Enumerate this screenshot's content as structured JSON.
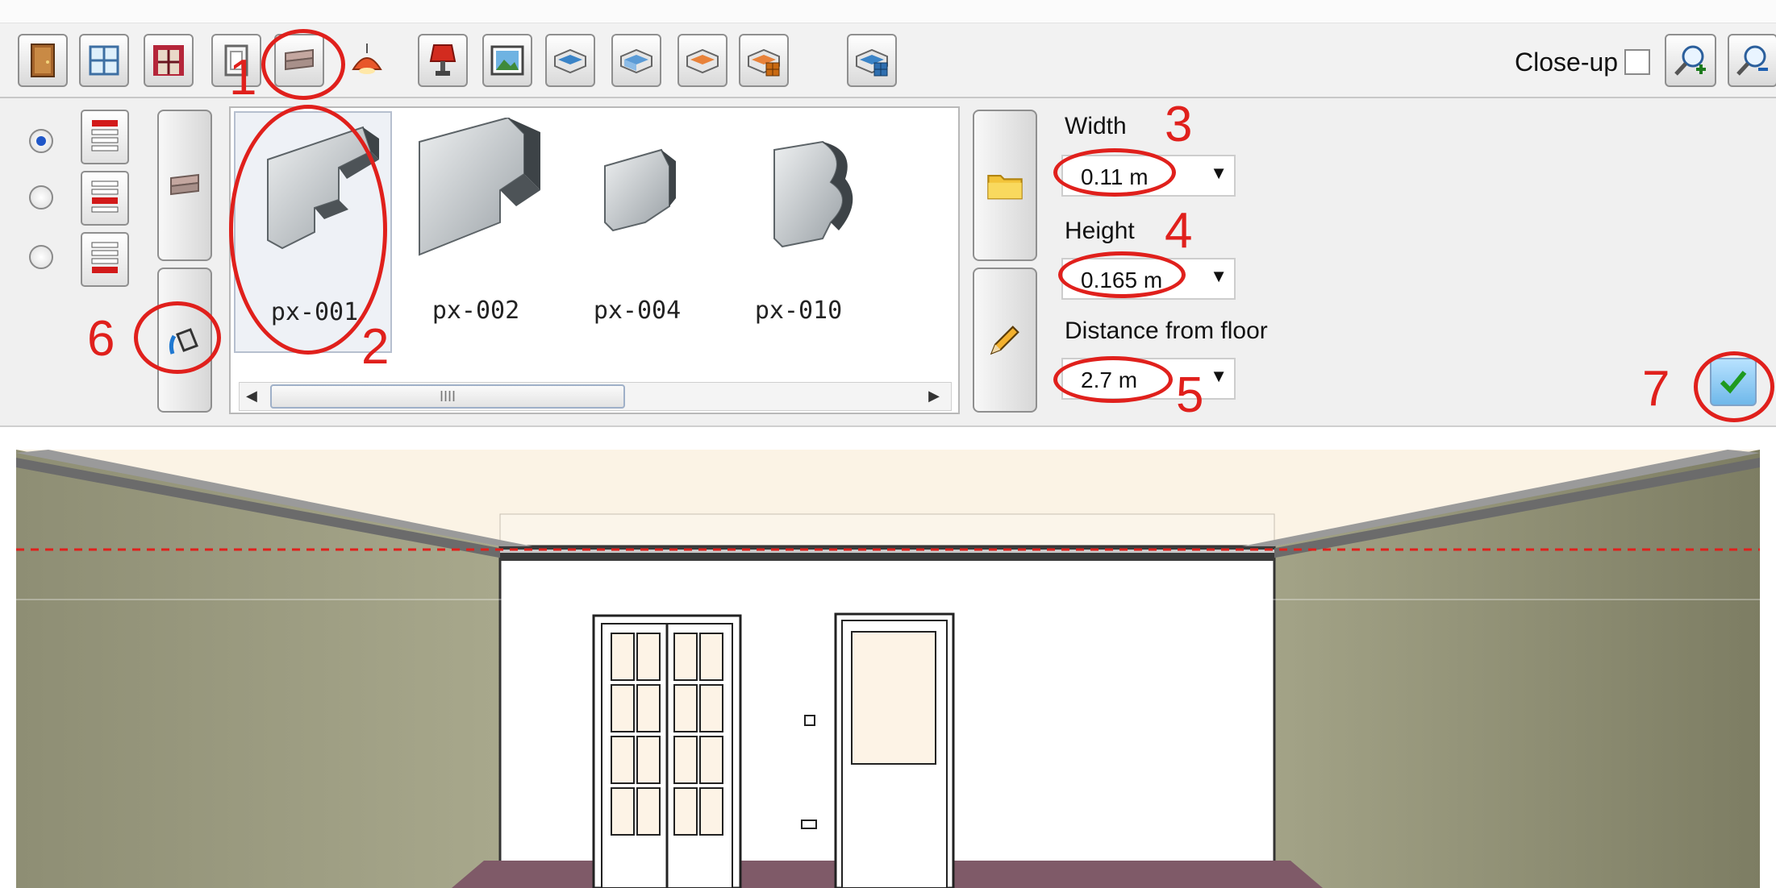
{
  "toolbar": {
    "buttons": [
      "door-icon",
      "window-icon",
      "opening-icon",
      "frame-icon",
      "cornice-icon",
      "ceiling-lamp-icon",
      "wall-lamp-icon",
      "picture-icon",
      "room-wall-icon",
      "room-floor-icon",
      "room-ceiling-icon",
      "room-tiles-icon",
      "room-grid-icon"
    ],
    "closeup_label": "Close-up",
    "closeup_checked": false
  },
  "side": {
    "radios": [
      true,
      false,
      false
    ],
    "buttons": [
      "cornice-icon",
      "paint-bucket-icon"
    ]
  },
  "catalog": {
    "items": [
      {
        "label": "px-001",
        "selected": true
      },
      {
        "label": "px-002",
        "selected": false
      },
      {
        "label": "px-004",
        "selected": false
      },
      {
        "label": "px-010",
        "selected": false
      }
    ],
    "scroll_grip": "IIII"
  },
  "fields": {
    "width": {
      "label": "Width",
      "value": "0.11 m"
    },
    "height": {
      "label": "Height",
      "value": "0.165 m"
    },
    "distance": {
      "label": "Distance from floor",
      "value": "2.7 m"
    }
  },
  "annotations": [
    "1",
    "2",
    "3",
    "4",
    "5",
    "6",
    "7"
  ],
  "colors": {
    "annotation": "#e0201c",
    "side_wall": "#8f8f74",
    "floor": "#7f5a68",
    "ceiling": "#fbf3e5",
    "dashed_line": "#e0201c",
    "apply_button": "#6fb8ea"
  }
}
